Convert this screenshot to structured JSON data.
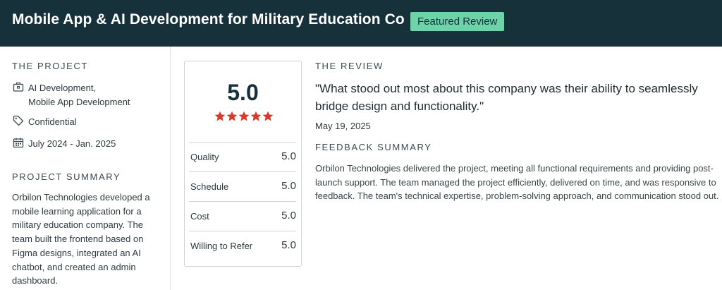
{
  "header": {
    "title": "Mobile App & AI Development for Military Education Co",
    "badge": "Featured Review"
  },
  "project": {
    "section_label": "THE PROJECT",
    "services_line1": "AI Development,",
    "services_line2": "Mobile App Development",
    "budget": "Confidential",
    "timeline": "July 2024 - Jan. 2025",
    "summary_label": "PROJECT SUMMARY",
    "summary": "Orbilon Technologies developed a mobile learning application for a military education company. The team built the frontend based on Figma designs, integrated an AI chatbot, and created an admin dashboard."
  },
  "rating": {
    "overall": "5.0",
    "stars": 5,
    "rows": [
      {
        "label": "Quality",
        "value": "5.0"
      },
      {
        "label": "Schedule",
        "value": "5.0"
      },
      {
        "label": "Cost",
        "value": "5.0"
      },
      {
        "label": "Willing to Refer",
        "value": "5.0"
      }
    ],
    "star_color": "#d93a2b"
  },
  "review": {
    "section_label": "THE REVIEW",
    "quote": "\"What stood out most about this company was their ability to seamlessly bridge design and functionality.\"",
    "date": "May 19, 2025",
    "feedback_label": "FEEDBACK SUMMARY",
    "feedback": "Orbilon Technologies delivered the project, meeting all functional requirements and providing post-launch support. The team managed the project efficiently, delivered on time, and was responsive to feedback. The team's technical expertise, problem-solving approach, and communication stood out."
  },
  "icons": {
    "services": "briefcase-icon",
    "budget": "price-tag-icon",
    "timeline": "calendar-icon",
    "star": "star-icon"
  },
  "colors": {
    "header_bg": "#17313b",
    "badge_bg": "#6ed3a8"
  }
}
